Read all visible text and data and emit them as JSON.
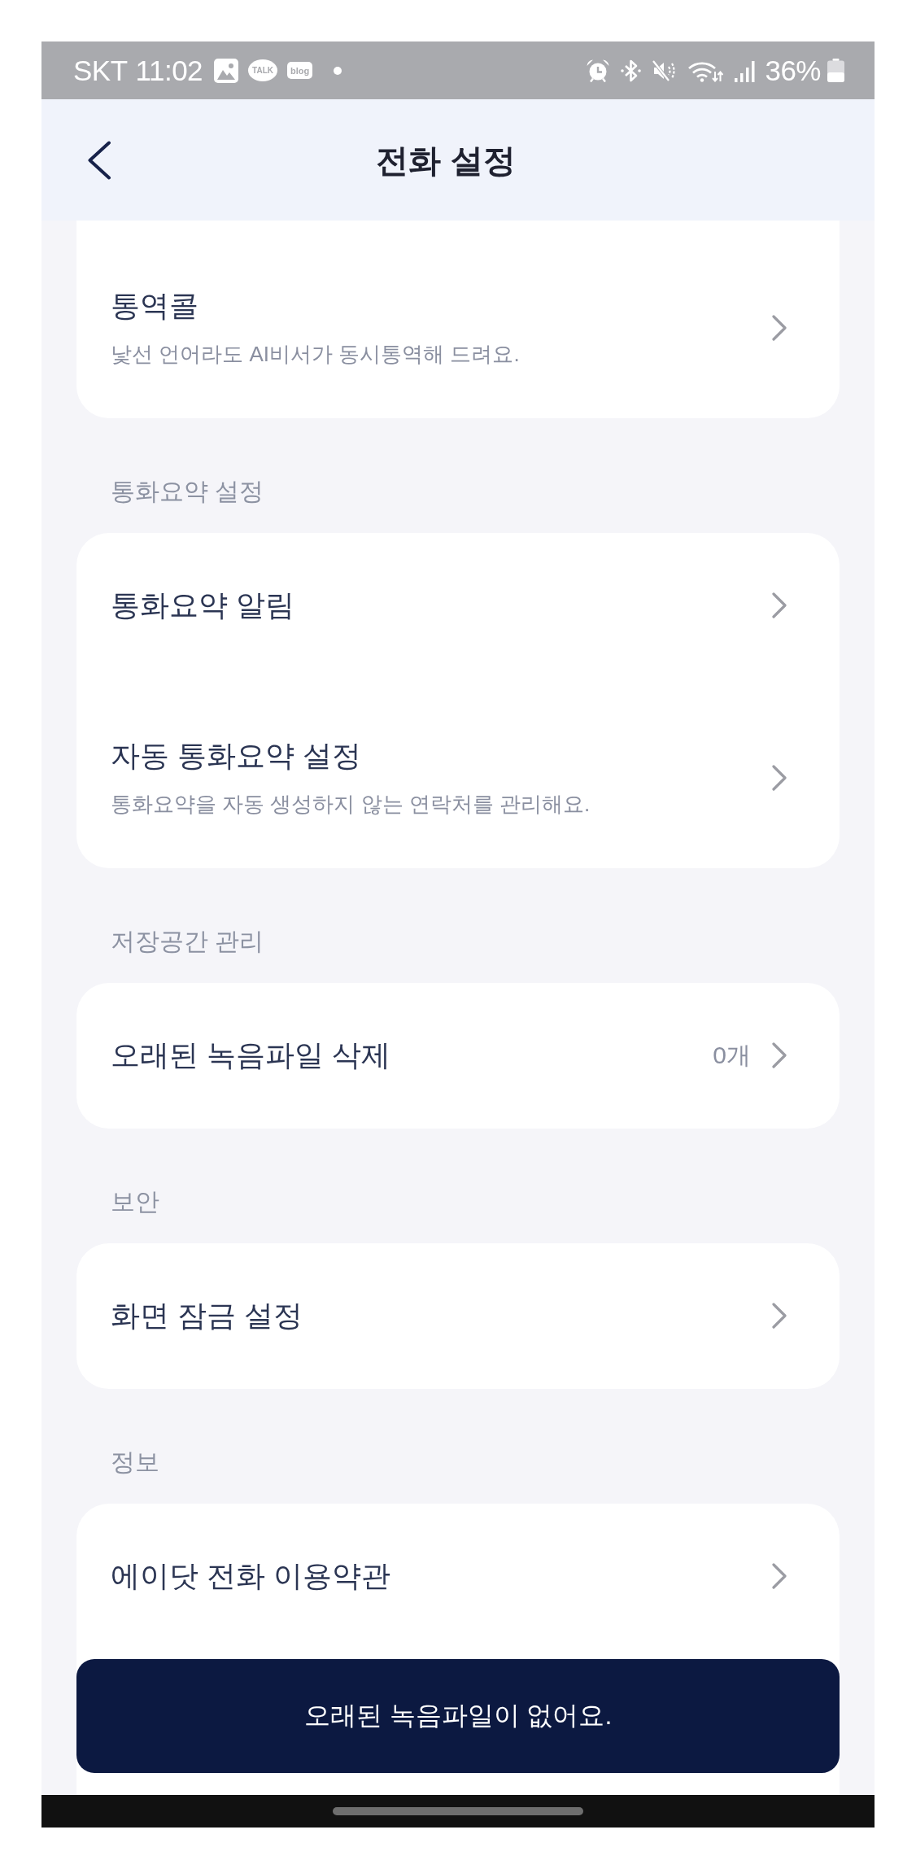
{
  "status_bar": {
    "carrier": "SKT",
    "time": "11:02",
    "notification_badges": [
      {
        "kind": "bubble",
        "label": "TALK"
      },
      {
        "kind": "tag",
        "label": "blog"
      }
    ],
    "battery": "36%"
  },
  "header": {
    "title": "전화 설정"
  },
  "groups": [
    {
      "items": [
        {
          "title": "통역콜",
          "subtitle": "낯선 언어라도 AI비서가 동시통역해 드려요."
        }
      ]
    },
    {
      "header": "통화요약 설정",
      "items": [
        {
          "title": "통화요약 알림"
        },
        {
          "title": "자동 통화요약 설정",
          "subtitle": "통화요약을 자동 생성하지 않는 연락처를 관리해요."
        }
      ]
    },
    {
      "header": "저장공간 관리",
      "items": [
        {
          "title": "오래된 녹음파일 삭제",
          "value": "0개"
        }
      ]
    },
    {
      "header": "보안",
      "items": [
        {
          "title": "화면 잠금 설정"
        }
      ]
    },
    {
      "header": "정보",
      "items": [
        {
          "title": "에이닷 전화 이용약관"
        }
      ]
    }
  ],
  "toast": {
    "message": "오래된 녹음파일이 없어요."
  }
}
